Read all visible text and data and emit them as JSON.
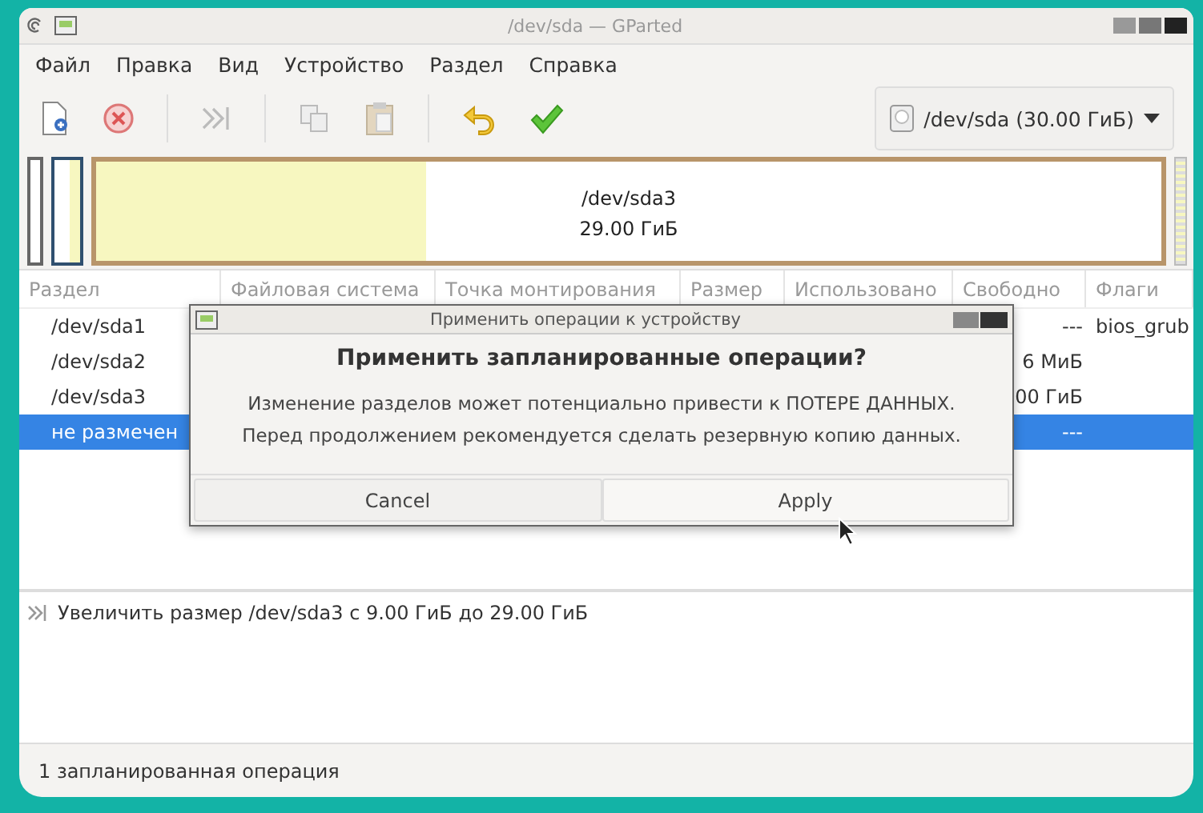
{
  "window": {
    "title": "/dev/sda — GParted"
  },
  "menu": [
    "Файл",
    "Правка",
    "Вид",
    "Устройство",
    "Раздел",
    "Справка"
  ],
  "device_selector": {
    "value": "/dev/sda (30.00 ГиБ)"
  },
  "disk_map": {
    "partition": "/dev/sda3",
    "size": "29.00 ГиБ",
    "level": 0.31
  },
  "table": {
    "columns": [
      "Раздел",
      "Файловая система",
      "Точка монтирования",
      "Размер",
      "Использовано",
      "Свободно",
      "Флаги"
    ],
    "rows": [
      {
        "partition": "/dev/sda1",
        "free": "---",
        "flags": "bios_grub",
        "selected": false
      },
      {
        "partition": "/dev/sda2",
        "free": "6 МиБ",
        "flags": "",
        "selected": false
      },
      {
        "partition": "/dev/sda3",
        "free": "00 ГиБ",
        "flags": "",
        "selected": false
      },
      {
        "partition": "не размечен",
        "free": "---",
        "flags": "",
        "selected": true
      }
    ]
  },
  "dialog": {
    "title": "Применить операции к устройству",
    "heading": "Применить запланированные операции?",
    "message": "Изменение разделов может потенциально привести к ПОТЕРЕ ДАННЫХ.\nПеред продолжением рекомендуется сделать резервную копию данных.",
    "buttons": [
      "Cancel",
      "Apply"
    ]
  },
  "operations": [
    "Увеличить размер /dev/sda3 с 9.00 ГиБ до 29.00 ГиБ"
  ],
  "status_bar": "1 запланированная операция"
}
